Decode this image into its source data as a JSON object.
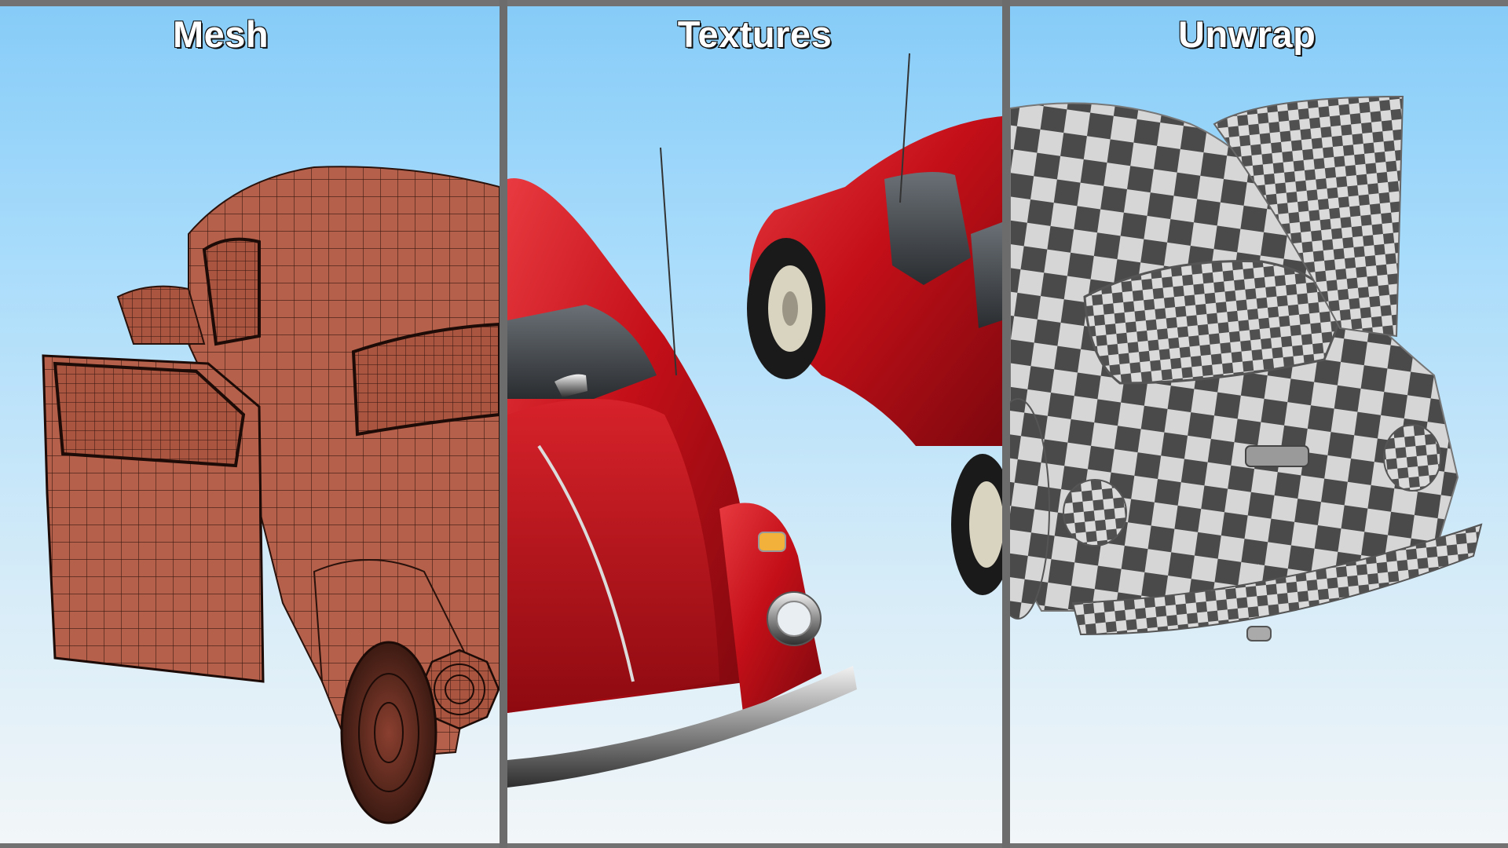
{
  "panels": [
    {
      "title": "Mesh"
    },
    {
      "title": "Textures"
    },
    {
      "title": "Unwrap"
    }
  ],
  "colors": {
    "frame": "#727272",
    "sky_top": "#86ccf8",
    "sky_bottom": "#f2f6f8",
    "mesh_body": "#b8614a",
    "paint_red": "#d1141c",
    "checker_dark": "#4a4a4a",
    "checker_light": "#d8d8d8"
  }
}
